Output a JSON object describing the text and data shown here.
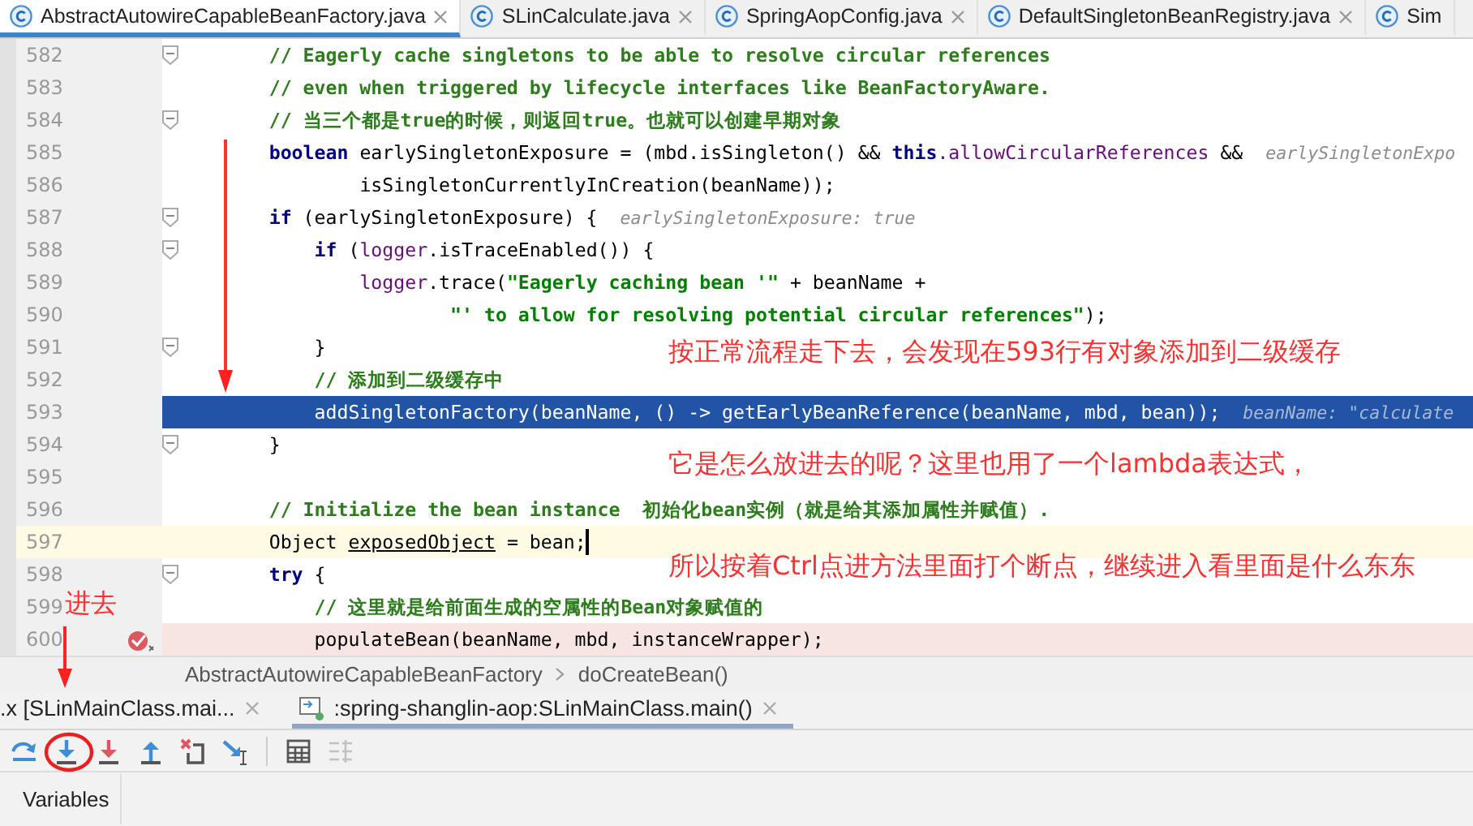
{
  "editor_tabs": [
    {
      "label": "AbstractAutowireCapableBeanFactory.java",
      "selected": true,
      "closable": true
    },
    {
      "label": "SLinCalculate.java",
      "selected": false,
      "closable": true
    },
    {
      "label": "SpringAopConfig.java",
      "selected": false,
      "closable": true
    },
    {
      "label": "DefaultSingletonBeanRegistry.java",
      "selected": false,
      "closable": true
    },
    {
      "label": "Sim",
      "selected": false,
      "closable": false
    }
  ],
  "editor": {
    "lines": [
      {
        "number": "582",
        "kind": "plain",
        "fold": true,
        "segments": [
          {
            "kind": "comment",
            "text": "        // Eagerly cache singletons to be able to resolve circular references"
          }
        ]
      },
      {
        "number": "583",
        "kind": "plain",
        "fold": false,
        "segments": [
          {
            "kind": "comment",
            "text": "        // even when triggered by lifecycle interfaces like BeanFactoryAware."
          }
        ]
      },
      {
        "number": "584",
        "kind": "plain",
        "fold": true,
        "segments": [
          {
            "kind": "comment",
            "text": "        // 当三个都是true的时候，则返回true。也就可以创建早期对象"
          }
        ]
      },
      {
        "number": "585",
        "kind": "plain",
        "fold": false,
        "segments": [
          {
            "kind": "keyword",
            "text": "        boolean"
          },
          {
            "kind": "plain",
            "text": " earlySingletonExposure = (mbd.isSingleton() && "
          },
          {
            "kind": "keyword",
            "text": "this"
          },
          {
            "kind": "field",
            "text": ".allowCircularReferences"
          },
          {
            "kind": "plain",
            "text": " &&"
          }
        ],
        "hint": "earlySingletonExpo"
      },
      {
        "number": "586",
        "kind": "plain",
        "fold": false,
        "segments": [
          {
            "kind": "plain",
            "text": "                isSingletonCurrentlyInCreation(beanName));"
          }
        ]
      },
      {
        "number": "587",
        "kind": "plain",
        "fold": true,
        "segments": [
          {
            "kind": "keyword",
            "text": "        if"
          },
          {
            "kind": "plain",
            "text": " (earlySingletonExposure) {"
          }
        ],
        "hint": "earlySingletonExposure: true"
      },
      {
        "number": "588",
        "kind": "plain",
        "fold": true,
        "segments": [
          {
            "kind": "keyword",
            "text": "            if"
          },
          {
            "kind": "plain",
            "text": " ("
          },
          {
            "kind": "field",
            "text": "logger"
          },
          {
            "kind": "plain",
            "text": ".isTraceEnabled()) {"
          }
        ]
      },
      {
        "number": "589",
        "kind": "plain",
        "fold": false,
        "segments": [
          {
            "kind": "field",
            "text": "                logger"
          },
          {
            "kind": "plain",
            "text": ".trace("
          },
          {
            "kind": "string",
            "text": "\"Eagerly caching bean '\""
          },
          {
            "kind": "plain",
            "text": " + beanName +"
          }
        ]
      },
      {
        "number": "590",
        "kind": "plain",
        "fold": false,
        "segments": [
          {
            "kind": "string",
            "text": "                        \"' to allow for resolving potential circular references\""
          },
          {
            "kind": "plain",
            "text": ");"
          }
        ]
      },
      {
        "number": "591",
        "kind": "plain",
        "fold": true,
        "segments": [
          {
            "kind": "plain",
            "text": "            }"
          }
        ]
      },
      {
        "number": "592",
        "kind": "plain",
        "fold": false,
        "segments": [
          {
            "kind": "comment",
            "text": "            // 添加到二级缓存中"
          }
        ]
      },
      {
        "number": "593",
        "kind": "execution",
        "fold": false,
        "segments": [
          {
            "kind": "plain",
            "text": "            addSingletonFactory(beanName, () -> getEarlyBeanReference(beanName, mbd, bean));"
          }
        ],
        "hint": "beanName: \"calculate"
      },
      {
        "number": "594",
        "kind": "plain",
        "fold": true,
        "segments": [
          {
            "kind": "plain",
            "text": "        }"
          }
        ]
      },
      {
        "number": "595",
        "kind": "plain",
        "fold": false
      },
      {
        "number": "596",
        "kind": "plain",
        "fold": false,
        "segments": [
          {
            "kind": "comment",
            "text": "        // Initialize the bean instance  初始化bean实例（就是给其添加属性并赋值）."
          }
        ]
      },
      {
        "number": "597",
        "kind": "caret",
        "fold": false,
        "segments": [
          {
            "kind": "plain",
            "text": "        Object "
          },
          {
            "kind": "variable",
            "text": "exposedObject"
          },
          {
            "kind": "plain",
            "text": " = bean;"
          }
        ]
      },
      {
        "number": "598",
        "kind": "plain",
        "fold": true,
        "segments": [
          {
            "kind": "keyword",
            "text": "        try"
          },
          {
            "kind": "plain",
            "text": " {"
          }
        ]
      },
      {
        "number": "599",
        "kind": "plain",
        "fold": false,
        "segments": [
          {
            "kind": "comment",
            "text": "            // 这里就是给前面生成的空属性的Bean对象赋值的"
          }
        ]
      },
      {
        "number": "600",
        "kind": "breakpoint",
        "fold": false,
        "segments": [
          {
            "kind": "plain",
            "text": "            populateBean(beanName, mbd, instanceWrapper);"
          }
        ]
      }
    ]
  },
  "annotations": [
    {
      "text": "按正常流程走下去，会发现在593行有对象添加到二级缓存"
    },
    {
      "text": "它是怎么放进去的呢？这里也用了一个lambda表达式，"
    },
    {
      "text": "所以按着Ctrl点进方法里面打个断点，继续进入看里面是什么东东"
    },
    {
      "text": "进去"
    }
  ],
  "breadcrumb": [
    "AbstractAutowireCapableBeanFactory",
    "doCreateBean()"
  ],
  "debug_tabs": [
    {
      "kind": "plain",
      "label": ".x [SLinMainClass.mai...",
      "selected": false
    },
    {
      "kind": "console",
      "label": ":spring-shanglin-aop:SLinMainClass.main()",
      "selected": true
    }
  ],
  "debug_toolbar": [
    {
      "kind": "step-over",
      "disabled": false
    },
    {
      "kind": "step-into",
      "disabled": false
    },
    {
      "kind": "force-step-into",
      "disabled": false
    },
    {
      "kind": "step-out",
      "disabled": false
    },
    {
      "kind": "drop-frame",
      "disabled": false
    },
    {
      "kind": "run-to-cursor",
      "disabled": false
    },
    {
      "kind": "evaluate",
      "disabled": false
    },
    {
      "kind": "trace",
      "disabled": true
    }
  ],
  "panel_tabs": [
    {
      "label": "Variables"
    }
  ]
}
